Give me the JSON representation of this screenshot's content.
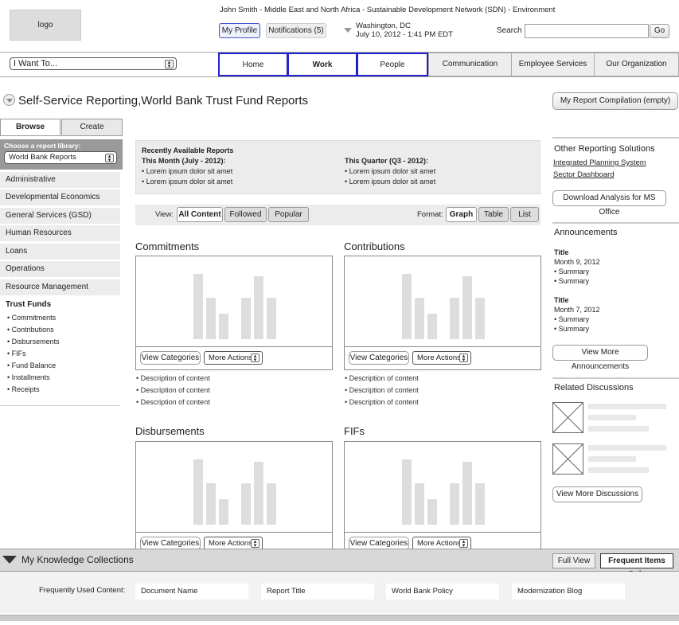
{
  "header": {
    "logo": "logo",
    "user_line": "John Smith - Middle East and North Africa - Sustainable Development Network (SDN) - Environment",
    "my_profile": "My Profile",
    "notifications": "Notifications (5)",
    "location": "Washington, DC",
    "datetime": "July 10, 2012 - 1:41 PM EDT",
    "search_label": "Search",
    "search_value": "",
    "go": "Go"
  },
  "nav": {
    "i_want_to": "I Want To...",
    "tabs": [
      "Home",
      "Work",
      "People",
      "Communication",
      "Employee Services",
      "Our Organization"
    ],
    "active_tab": "Work"
  },
  "page": {
    "title_prefix": "Self-Service Reporting,",
    "title": "World Bank Trust Fund Reports",
    "my_report": "My Report Compilation (empty)"
  },
  "sidebar": {
    "tab_browse": "Browse",
    "tab_create": "Create",
    "choose_label": "Choose a report library:",
    "library_value": "World Bank Reports",
    "items": [
      "Administrative",
      "Developmental Economics",
      "General Services (GSD)",
      "Human Resources",
      "Loans",
      "Operations",
      "Resource Management"
    ],
    "trust_funds_label": "Trust Funds",
    "trust_funds_items": [
      "• Commitments",
      "• Contributions",
      "• Disbursements",
      "• FIFs",
      "• Fund Balance",
      "• Installments",
      "• Receipts"
    ]
  },
  "recent": {
    "heading": "Recently Available Reports",
    "month_heading": "This Month (July - 2012):",
    "month_items": [
      "• Lorem ipsum dolor sit amet",
      "• Lorem ipsum dolor sit amet"
    ],
    "quarter_heading": "This Quarter (Q3 - 2012):",
    "quarter_items": [
      "• Lorem ipsum dolor sit amet",
      "• Lorem ipsum dolor sit amet"
    ]
  },
  "view_bar": {
    "view_label": "View:",
    "view_options": [
      "All Content",
      "Followed",
      "Popular"
    ],
    "format_label": "Format:",
    "format_options": [
      "Graph",
      "Table",
      "List"
    ]
  },
  "panels": [
    {
      "title": "Commitments",
      "view_categories": "View Categories",
      "more_actions": "More Actions",
      "descs": [
        "•  Description of content",
        "•  Description of content",
        "•  Description of content"
      ]
    },
    {
      "title": "Contributions",
      "view_categories": "View Categories",
      "more_actions": "More Actions",
      "descs": [
        "•  Description of content",
        "•  Description of content",
        "•  Description of content"
      ]
    },
    {
      "title": "Disbursements",
      "view_categories": "View Categories",
      "more_actions": "More Actions",
      "descs": []
    },
    {
      "title": "FIFs",
      "view_categories": "View Categories",
      "more_actions": "More Actions",
      "descs": []
    }
  ],
  "right": {
    "other_heading": "Other Reporting Solutions",
    "link1": "Integrated Planning System",
    "link2": "Sector Dashboard",
    "download": "Download Analysis for MS Office",
    "announcements_heading": "Announcements",
    "announcements": [
      {
        "title": "Title",
        "date": "Month 9, 2012",
        "s1": "• Summary",
        "s2": "• Summary"
      },
      {
        "title": "Title",
        "date": "Month 7, 2012",
        "s1": "• Summary",
        "s2": "• Summary"
      }
    ],
    "view_more_announcements": "View More Announcements",
    "discussions_heading": "Related Discussions",
    "view_more_discussions": "View More Discussions"
  },
  "knowledge": {
    "heading": "My Knowledge Collections",
    "full_view": "Full View",
    "frequent_only": "Frequent Items Only",
    "label": "Frequently Used Content:",
    "items": [
      "Document Name",
      "Report Title",
      "World Bank Policy",
      "Modernization Blog"
    ]
  }
}
